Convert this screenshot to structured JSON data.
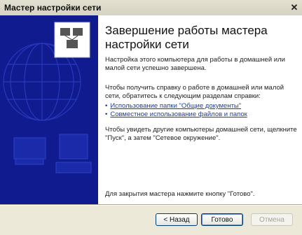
{
  "window": {
    "title": "Мастер настройки сети"
  },
  "content": {
    "heading": "Завершение работы мастера настройки сети",
    "para1": "Настройка этого компьютера для работы в домашней или малой сети успешно завершена.",
    "para2": "Чтобы получить справку о работе в домашней или малой сети, обратитесь к следующим разделам справки:",
    "links": [
      "Использование папки \"Общие документы\"",
      "Совместное использование файлов и папок"
    ],
    "para3": "Чтобы увидеть другие компьютеры домашней сети, щелкните \"Пуск\", а затем \"Сетевое окружение\".",
    "para4": "Для закрытия мастера нажмите кнопку \"Готово\"."
  },
  "buttons": {
    "back": "< Назад",
    "finish": "Готово",
    "cancel": "Отмена"
  },
  "colors": {
    "panel": "#0f1b8f",
    "link": "#1d3f9a"
  }
}
